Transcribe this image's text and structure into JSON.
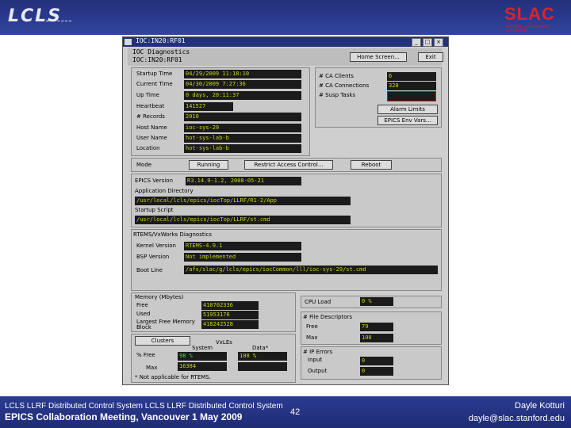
{
  "slide": {
    "logo_left": "LCLS",
    "logo_right": "SLAC",
    "logo_right_sub": "NATIONAL ACCELERATOR LABORATORY",
    "footer_line1": "LCLS LLRF Distributed Control System LCLS LLRF Distributed Control System",
    "footer_line2": "EPICS Collaboration Meeting, Vancouver 1 May 2009",
    "page_number": "42",
    "author": "Dayle Kotturi",
    "email": "dayle@slac.stanford.edu"
  },
  "window": {
    "title": "IOC:IN20:RF01",
    "header_line1": "IOC Diagnostics",
    "header_line2": "IOC:IN20:RF01",
    "home_button": "Home Screen...",
    "exit_button": "Exit",
    "info": {
      "labels": [
        "Startup Time",
        "Current Time",
        "Up Time",
        "Heartbeat",
        "# Records",
        "Host Name",
        "User Name",
        "Location"
      ],
      "values": [
        "04/29/2009 11:18:10",
        "04/30/2009 7:27:36",
        "0 days, 20:11:37",
        "141527",
        "2010",
        "ioc-sys-29",
        "hot-sys-lab-b",
        "hot-sys-lab-b"
      ]
    },
    "ca": {
      "labels": [
        "# CA Clients",
        "# CA Connections",
        "# Susp Tasks"
      ],
      "values": [
        "6",
        "328",
        ""
      ],
      "alarm_button": "Alarm Limits",
      "epics_button": "EPICS Env Vars..."
    },
    "mode": {
      "label": "Mode",
      "button": "Running",
      "access_button": "Restrict Access Control...",
      "reboot_button": "Reboot"
    },
    "epics": {
      "version_label": "EPICS Version",
      "version": "R3.14.9-1.2, 2008-05-21",
      "app_dir_label": "Application Directory",
      "app_dir": "/usr/local/lcls/epics/iocTop/LLRF/R1-2/App",
      "startup_label": "Startup Script",
      "startup": "/usr/local/lcls/epics/iocTop/LLRF/st.cmd"
    },
    "rtems": {
      "section_label": "RTEMS/VxWorks Diagnostics",
      "kernel_label": "Kernel Version",
      "kernel": "RTEMS-4.9.1",
      "bsp_label": "BSP Version",
      "bsp": "Not implemented",
      "boot_label": "Boot Line",
      "boot": "/afs/slac/g/lcls/epics/iocCommon/lll/ioc-sys-29/st.cmd"
    },
    "memory": {
      "section_label": "Memory (Mbytes)",
      "labels": [
        "Free",
        "Used",
        "Largest Free Memory Block"
      ],
      "values": [
        "410702336",
        "51953176",
        "418242528"
      ]
    },
    "clusters": {
      "button": "Clusters",
      "vx_label": "VxLEs",
      "col1": "System",
      "col2": "Data*",
      "row1_label": "% Free",
      "row1_values": [
        "98 %",
        "100 %"
      ],
      "row2_label": "Max",
      "row2_values": [
        "16384",
        ""
      ],
      "note": "* Not applicable for RTEMS."
    },
    "cpu": {
      "label": "CPU Load",
      "value": "0 %"
    },
    "fd": {
      "section_label": "# File Descriptors",
      "free_label": "Free",
      "free": "79",
      "max_label": "Max",
      "max": "100"
    },
    "errors": {
      "section_label": "# IP Errors",
      "input_label": "Input",
      "input": "0",
      "output_label": "Output",
      "output": "0"
    }
  }
}
